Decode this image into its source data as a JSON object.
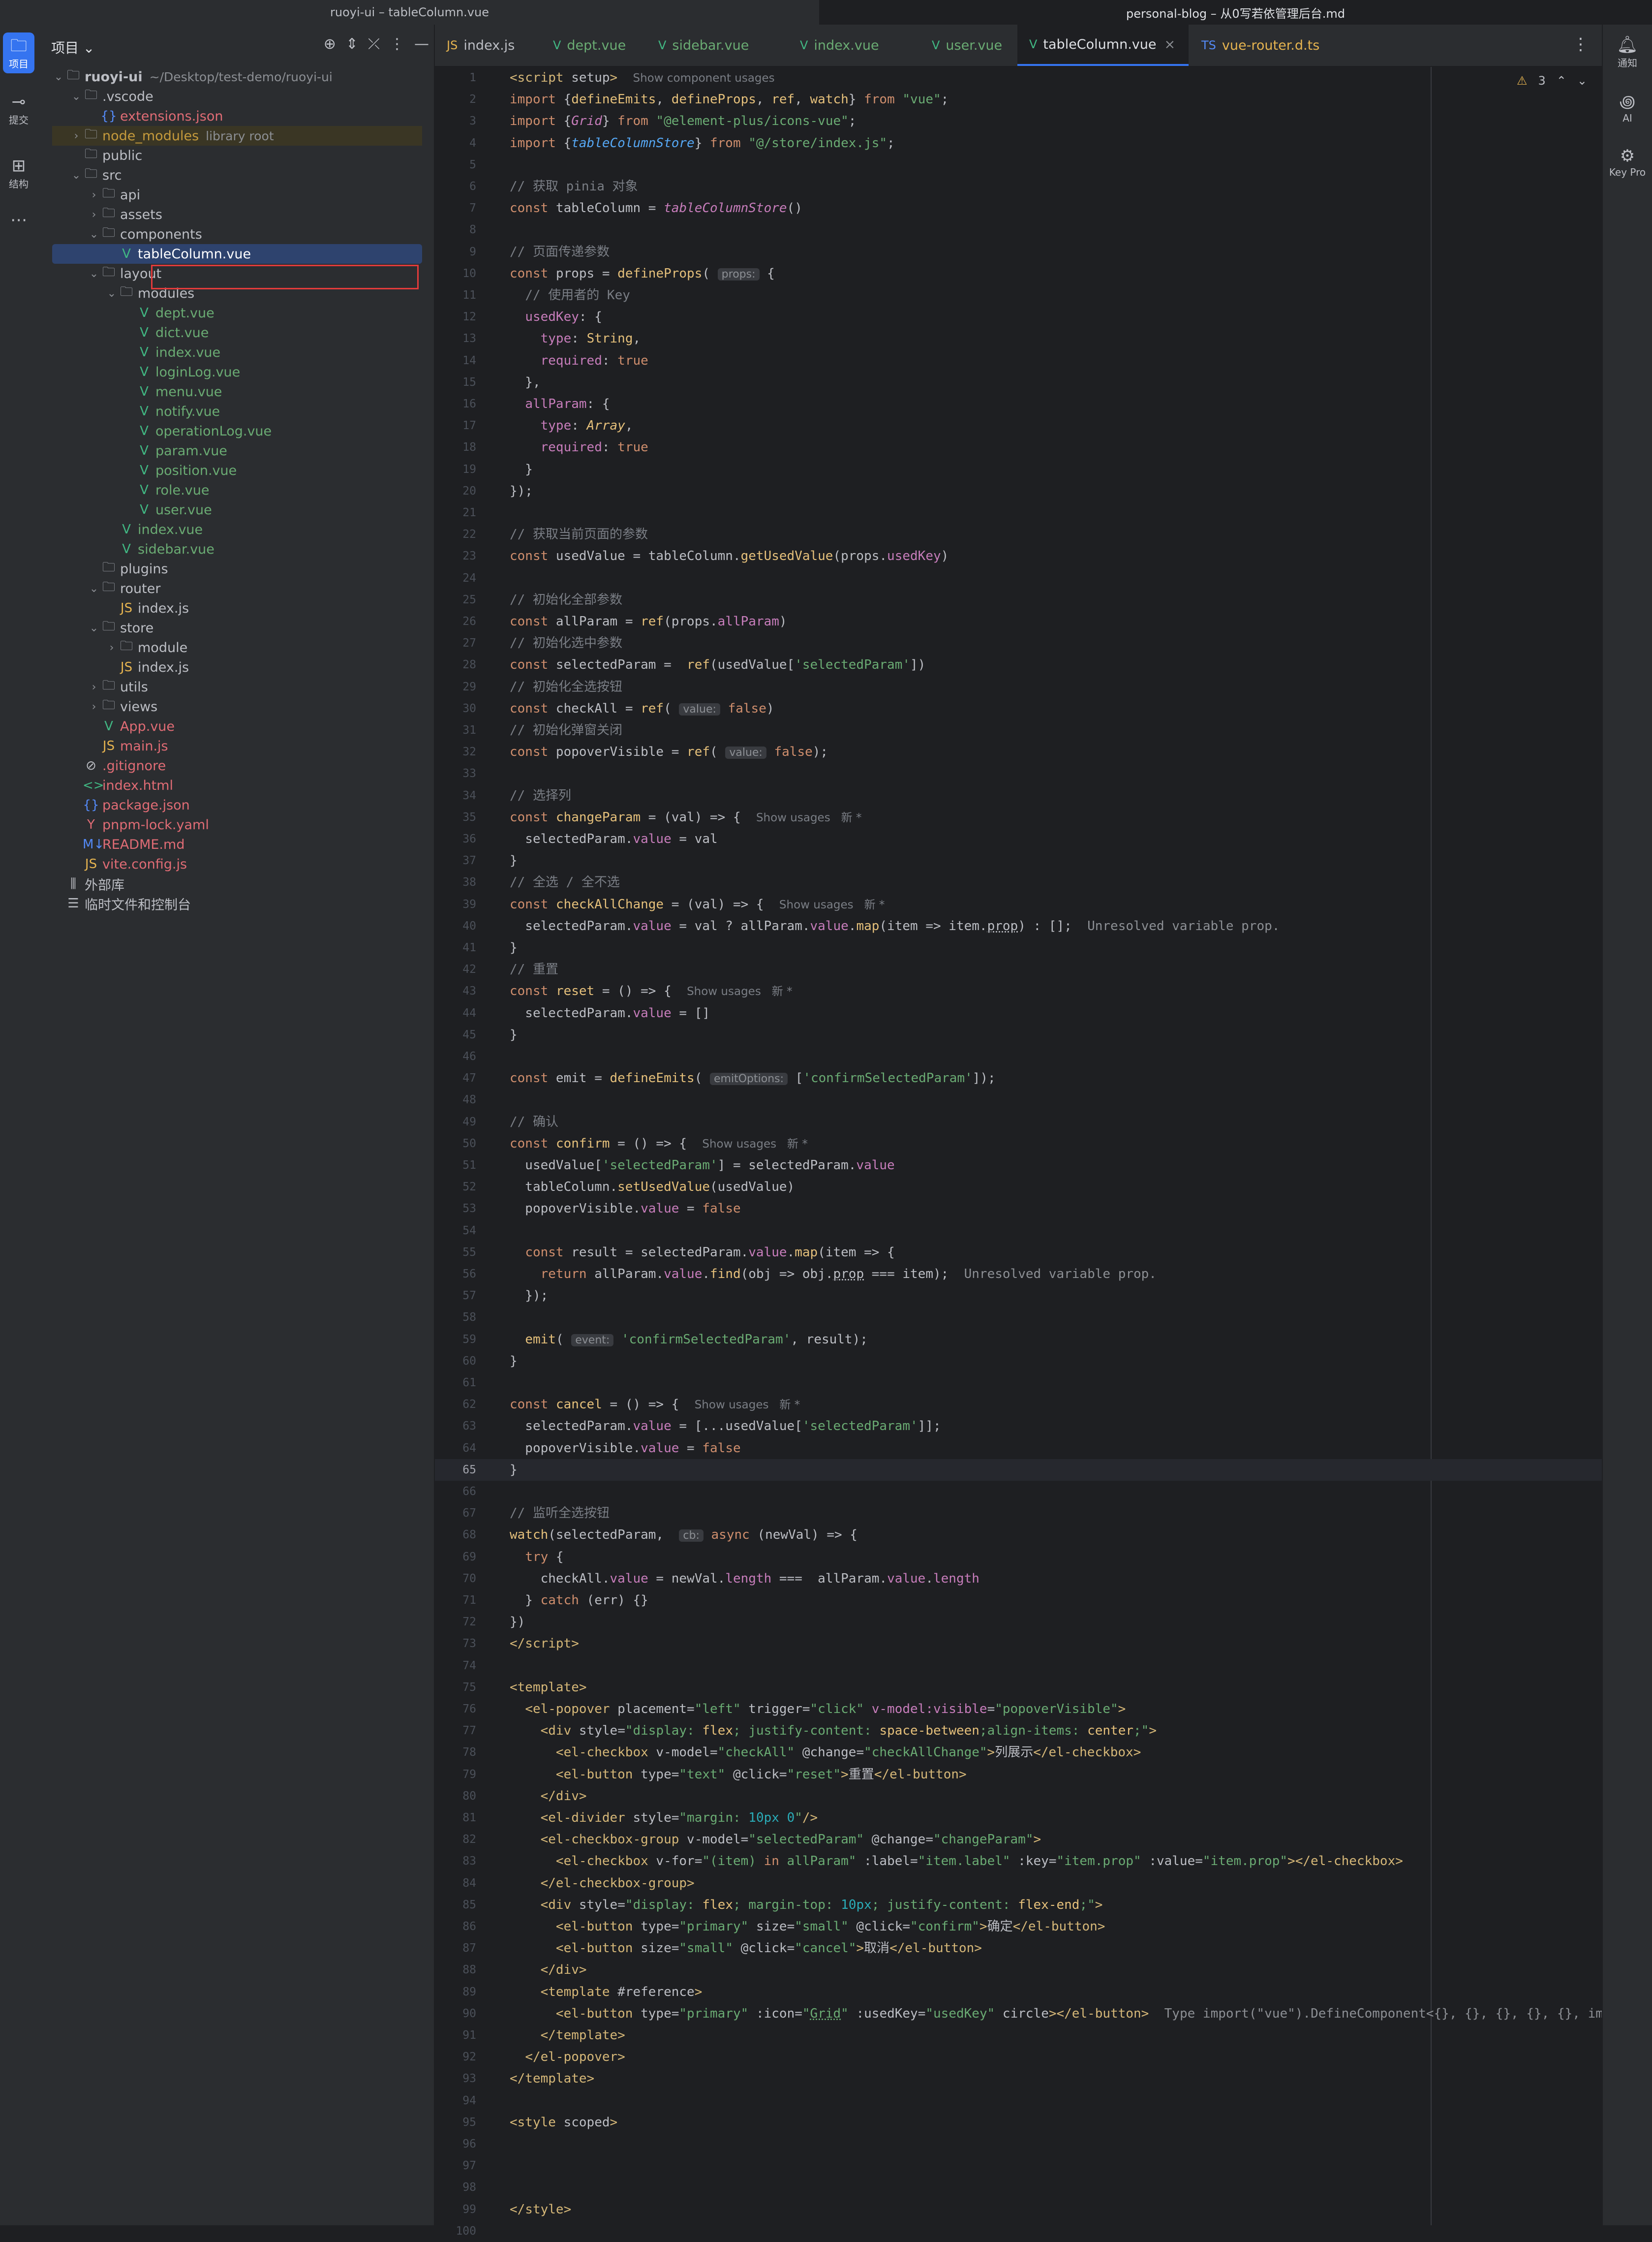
{
  "window": {
    "left_title": "ruoyi-ui – tableColumn.vue",
    "right_title": "personal-blog – 从0写若依管理后台.md"
  },
  "left_activity": [
    {
      "label": "项目",
      "icon": "folder-icon"
    },
    {
      "label": "提交",
      "icon": "commit-icon"
    },
    {
      "label": "结构",
      "icon": "structure-icon"
    },
    {
      "label": "⋯",
      "icon": "more-icon"
    }
  ],
  "right_activity": [
    {
      "label": "通知",
      "icon": "bell-icon"
    },
    {
      "label": "AI",
      "icon": "ai-icon"
    },
    {
      "label": "Key Pro",
      "icon": "key-promoter-icon"
    }
  ],
  "project": {
    "title": "项目",
    "tree": [
      {
        "depth": 0,
        "chev": "v",
        "icon": "folder",
        "label": "ruoyi-ui",
        "hint": "~/Desktop/test-demo/ruoyi-ui",
        "bold": true
      },
      {
        "depth": 1,
        "chev": "v",
        "icon": "folder",
        "label": ".vscode"
      },
      {
        "depth": 2,
        "chev": "",
        "icon": "json",
        "label": "extensions.json",
        "color": "red"
      },
      {
        "depth": 1,
        "chev": ">",
        "icon": "folder",
        "label": "node_modules",
        "hint": "library root",
        "dim": true
      },
      {
        "depth": 1,
        "chev": "",
        "icon": "folder",
        "label": "public"
      },
      {
        "depth": 1,
        "chev": "v",
        "icon": "folder",
        "label": "src"
      },
      {
        "depth": 2,
        "chev": ">",
        "icon": "folder",
        "label": "api"
      },
      {
        "depth": 2,
        "chev": ">",
        "icon": "folder",
        "label": "assets"
      },
      {
        "depth": 2,
        "chev": "v",
        "icon": "folder",
        "label": "components"
      },
      {
        "depth": 3,
        "chev": "",
        "icon": "vue",
        "label": "tableColumn.vue",
        "selected": true
      },
      {
        "depth": 2,
        "chev": "v",
        "icon": "folder",
        "label": "layout"
      },
      {
        "depth": 3,
        "chev": "v",
        "icon": "folder",
        "label": "modules"
      },
      {
        "depth": 4,
        "chev": "",
        "icon": "vue",
        "label": "dept.vue"
      },
      {
        "depth": 4,
        "chev": "",
        "icon": "vue",
        "label": "dict.vue"
      },
      {
        "depth": 4,
        "chev": "",
        "icon": "vue",
        "label": "index.vue"
      },
      {
        "depth": 4,
        "chev": "",
        "icon": "vue",
        "label": "loginLog.vue"
      },
      {
        "depth": 4,
        "chev": "",
        "icon": "vue",
        "label": "menu.vue"
      },
      {
        "depth": 4,
        "chev": "",
        "icon": "vue",
        "label": "notify.vue"
      },
      {
        "depth": 4,
        "chev": "",
        "icon": "vue",
        "label": "operationLog.vue"
      },
      {
        "depth": 4,
        "chev": "",
        "icon": "vue",
        "label": "param.vue"
      },
      {
        "depth": 4,
        "chev": "",
        "icon": "vue",
        "label": "position.vue"
      },
      {
        "depth": 4,
        "chev": "",
        "icon": "vue",
        "label": "role.vue"
      },
      {
        "depth": 4,
        "chev": "",
        "icon": "vue",
        "label": "user.vue"
      },
      {
        "depth": 3,
        "chev": "",
        "icon": "vue",
        "label": "index.vue"
      },
      {
        "depth": 3,
        "chev": "",
        "icon": "vue",
        "label": "sidebar.vue"
      },
      {
        "depth": 2,
        "chev": "",
        "icon": "folder",
        "label": "plugins"
      },
      {
        "depth": 2,
        "chev": "v",
        "icon": "folder",
        "label": "router"
      },
      {
        "depth": 3,
        "chev": "",
        "icon": "js",
        "label": "index.js"
      },
      {
        "depth": 2,
        "chev": "v",
        "icon": "folder",
        "label": "store"
      },
      {
        "depth": 3,
        "chev": ">",
        "icon": "folder",
        "label": "module"
      },
      {
        "depth": 3,
        "chev": "",
        "icon": "js",
        "label": "index.js"
      },
      {
        "depth": 2,
        "chev": ">",
        "icon": "folder",
        "label": "utils"
      },
      {
        "depth": 2,
        "chev": ">",
        "icon": "folder",
        "label": "views"
      },
      {
        "depth": 2,
        "chev": "",
        "icon": "vue",
        "label": "App.vue",
        "color": "red"
      },
      {
        "depth": 2,
        "chev": "",
        "icon": "js",
        "label": "main.js",
        "color": "red"
      },
      {
        "depth": 1,
        "chev": "",
        "icon": "ignore",
        "label": ".gitignore",
        "color": "red"
      },
      {
        "depth": 1,
        "chev": "",
        "icon": "html",
        "label": "index.html",
        "color": "red"
      },
      {
        "depth": 1,
        "chev": "",
        "icon": "json",
        "label": "package.json",
        "color": "red"
      },
      {
        "depth": 1,
        "chev": "",
        "icon": "yaml",
        "label": "pnpm-lock.yaml",
        "color": "red"
      },
      {
        "depth": 1,
        "chev": "",
        "icon": "md",
        "label": "README.md",
        "color": "red"
      },
      {
        "depth": 1,
        "chev": "",
        "icon": "js",
        "label": "vite.config.js",
        "color": "red"
      },
      {
        "depth": 0,
        "chev": "",
        "icon": "lib",
        "label": "外部库",
        "white": true
      },
      {
        "depth": 0,
        "chev": "",
        "icon": "scratch",
        "label": "临时文件和控制台",
        "white": true
      }
    ]
  },
  "tabs": [
    {
      "label": "index.js",
      "icon": "js"
    },
    {
      "label": "dept.vue",
      "icon": "vue"
    },
    {
      "label": "sidebar.vue",
      "icon": "vue"
    },
    {
      "label": "index.vue",
      "icon": "vue"
    },
    {
      "label": "user.vue",
      "icon": "vue"
    },
    {
      "label": "tableColumn.vue",
      "icon": "vue",
      "active": true
    },
    {
      "label": "vue-router.d.ts",
      "icon": "ts"
    }
  ],
  "inspection": {
    "warnings": "3"
  },
  "current_line": 65,
  "code": [
    "<span class='tg'>&lt;script</span> <span class='at'>setup</span><span class='tg'>&gt;</span>  <span class='hint'>Show component usages</span>",
    "<span class='k'>import</span> {<span class='fd'>defineEmits</span>, <span class='fd'>defineProps</span>, <span class='fd'>ref</span>, <span class='fd'>watch</span>} <span class='k'>from</span> <span class='s'>\"vue\"</span>;",
    "<span class='k'>import</span> {<span class='p it'>Grid</span>} <span class='k'>from</span> <span class='s'>\"@element-plus/icons-vue\"</span>;",
    "<span class='k'>import</span> {<span class='fn it'>tableColumnStore</span>} <span class='k'>from</span> <span class='s'>\"@/store/index.js\"</span>;",
    "",
    "<span class='cm'>// 获取 pinia 对象</span>",
    "<span class='k'>const</span> tableColumn = <span class='p it'>tableColumnStore</span>()",
    "",
    "<span class='cm'>// 页面传递参数</span>",
    "<span class='k'>const</span> props = <span class='fd'>defineProps</span>( <span class='inl'>props:</span> {",
    "  <span class='cm'>// 使用者的 Key</span>",
    "  <span class='p'>usedKey</span>: {",
    "    <span class='p'>type</span>: <span class='fd'>String</span>,",
    "    <span class='p'>required</span>: <span class='k'>true</span>",
    "  },",
    "  <span class='p'>allParam</span>: {",
    "    <span class='p'>type</span>: <span class='fd it'>Array</span>,",
    "    <span class='p'>required</span>: <span class='k'>true</span>",
    "  }",
    "});",
    "",
    "<span class='cm'>// 获取当前页面的参数</span>",
    "<span class='k'>const</span> usedValue = tableColumn.<span class='fd'>getUsedValue</span>(props.<span class='p'>usedKey</span>)",
    "",
    "<span class='cm'>// 初始化全部参数</span>",
    "<span class='k'>const</span> allParam = <span class='fd'>ref</span>(props.<span class='p'>allParam</span>)",
    "<span class='cm'>// 初始化选中参数</span>",
    "<span class='k'>const</span> selectedParam =  <span class='fd'>ref</span>(usedValue[<span class='s'>'selectedParam'</span>])",
    "<span class='cm'>// 初始化全选按钮</span>",
    "<span class='k'>const</span> checkAll = <span class='fd'>ref</span>( <span class='inl'>value:</span> <span class='k'>false</span>)",
    "<span class='cm'>// 初始化弹窗关闭</span>",
    "<span class='k'>const</span> popoverVisible = <span class='fd'>ref</span>( <span class='inl'>value:</span> <span class='k'>false</span>);",
    "",
    "<span class='cm'>// 选择列</span>",
    "<span class='k'>const</span> <span class='fd'>changeParam</span> = (val) => {  <span class='hint'>Show usages   新 *</span>",
    "  selectedParam.<span class='p'>value</span> = val",
    "}",
    "<span class='cm'>// 全选 / 全不选</span>",
    "<span class='k'>const</span> <span class='fd'>checkAllChange</span> = (val) => {  <span class='hint'>Show usages   新 *</span>",
    "  selectedParam.<span class='p'>value</span> = val ? allParam.<span class='p'>value</span>.<span class='fd'>map</span>(item => item.<span class='ul'>prop</span>) : [];  <span class='warnmsg'>Unresolved variable prop.</span>",
    "}",
    "<span class='cm'>// 重置</span>",
    "<span class='k'>const</span> <span class='fd'>reset</span> = () => {  <span class='hint'>Show usages   新 *</span>",
    "  selectedParam.<span class='p'>value</span> = []",
    "}",
    "",
    "<span class='k'>const</span> emit = <span class='fd'>defineEmits</span>( <span class='inl'>emitOptions:</span> [<span class='s'>'confirmSelectedParam'</span>]);",
    "",
    "<span class='cm'>// 确认</span>",
    "<span class='k'>const</span> <span class='fd'>confirm</span> = () => {  <span class='hint'>Show usages   新 *</span>",
    "  usedValue[<span class='s'>'selectedParam'</span>] = selectedParam.<span class='p'>value</span>",
    "  tableColumn.<span class='fd'>setUsedValue</span>(usedValue)",
    "  popoverVisible.<span class='p'>value</span> = <span class='k'>false</span>",
    "",
    "  <span class='k'>const</span> result = selectedParam.<span class='p'>value</span>.<span class='fd'>map</span>(item => {",
    "    <span class='k'>return</span> allParam.<span class='p'>value</span>.<span class='fd'>find</span>(obj => obj.<span class='ul'>prop</span> === item);  <span class='warnmsg'>Unresolved variable prop.</span>",
    "  });",
    "",
    "  <span class='fd'>emit</span>( <span class='inl'>event:</span> <span class='s'>'confirmSelectedParam'</span>, result);",
    "}",
    "",
    "<span class='k'>const</span> <span class='fd'>cancel</span> = () => {  <span class='hint'>Show usages   新 *</span>",
    "  selectedParam.<span class='p'>value</span> = [...usedValue[<span class='s'>'selectedParam'</span>]];",
    "  popoverVisible.<span class='p'>value</span> = <span class='k'>false</span>",
    "}",
    "",
    "<span class='cm'>// 监听全选按钮</span>",
    "<span class='fd'>watch</span>(selectedParam,  <span class='inl'>cb:</span> <span class='k'>async</span> (newVal) => {",
    "  <span class='k'>try</span> {",
    "    checkAll.<span class='p'>value</span> = newVal.<span class='p'>length</span> ===  allParam.<span class='p'>value</span>.<span class='p'>length</span>",
    "  } <span class='k'>catch</span> (err) {}",
    "})",
    "<span class='tg'>&lt;/script&gt;</span>",
    "",
    "<span class='tg'>&lt;template&gt;</span>",
    "  <span class='tg'>&lt;el-popover</span> <span class='at'>placement</span>=<span class='av'>\"left\"</span> <span class='at'>trigger</span>=<span class='av'>\"click\"</span> <span class='p'>v-model:visible</span>=<span class='av'>\"popoverVisible\"</span><span class='tg'>&gt;</span>",
    "    <span class='tg'>&lt;div</span> <span class='at'>style</span>=<span class='av'>\"display: <span class='fd'>flex</span>; justify-content: <span class='fd'>space-between</span>;align-items: <span class='fd'>center</span>;\"</span><span class='tg'>&gt;</span>",
    "      <span class='tg'>&lt;el-checkbox</span> <span class='at'>v-model</span>=<span class='av'>\"checkAll\"</span> <span class='at'>@change</span>=<span class='av'>\"checkAllChange\"</span><span class='tg'>&gt;</span>列展示<span class='tg'>&lt;/el-checkbox&gt;</span>",
    "      <span class='tg'>&lt;el-button</span> <span class='at'>type</span>=<span class='av'>\"text\"</span> <span class='at'>@click</span>=<span class='av'>\"reset\"</span><span class='tg'>&gt;</span>重置<span class='tg'>&lt;/el-button&gt;</span>",
    "    <span class='tg'>&lt;/div&gt;</span>",
    "    <span class='tg'>&lt;el-divider</span> <span class='at'>style</span>=<span class='av'>\"margin: <span class='nu'>10px</span> <span class='nu'>0</span>\"</span><span class='tg'>/&gt;</span>",
    "    <span class='tg'>&lt;el-checkbox-group</span> <span class='at'>v-model</span>=<span class='av'>\"selectedParam\"</span> <span class='at'>@change</span>=<span class='av'>\"changeParam\"</span><span class='tg'>&gt;</span>",
    "      <span class='tg'>&lt;el-checkbox</span> <span class='at'>v-for</span>=<span class='av'>\"(item) <span class='k'>in</span> allParam\"</span> <span class='at'>:label</span>=<span class='av'>\"item.label\"</span> <span class='at'>:key</span>=<span class='av'>\"item.prop\"</span> <span class='at'>:value</span>=<span class='av'>\"item.prop\"</span><span class='tg'>&gt;&lt;/el-checkbox&gt;</span>",
    "    <span class='tg'>&lt;/el-checkbox-group&gt;</span>",
    "    <span class='tg'>&lt;div</span> <span class='at'>style</span>=<span class='av'>\"display: <span class='fd'>flex</span>; margin-top: <span class='nu'>10px</span>; justify-content: <span class='fd'>flex-end</span>;\"</span><span class='tg'>&gt;</span>",
    "      <span class='tg'>&lt;el-button</span> <span class='at'>type</span>=<span class='av'>\"primary\"</span> <span class='at'>size</span>=<span class='av'>\"small\"</span> <span class='at'>@click</span>=<span class='av'>\"confirm\"</span><span class='tg'>&gt;</span>确定<span class='tg'>&lt;/el-button&gt;</span>",
    "      <span class='tg'>&lt;el-button</span> <span class='at'>size</span>=<span class='av'>\"small\"</span> <span class='at'>@click</span>=<span class='av'>\"cancel\"</span><span class='tg'>&gt;</span>取消<span class='tg'>&lt;/el-button&gt;</span>",
    "    <span class='tg'>&lt;/div&gt;</span>",
    "    <span class='tg'>&lt;template</span> <span class='at'>#reference</span><span class='tg'>&gt;</span>",
    "      <span class='tg'>&lt;el-button</span> <span class='at'>type</span>=<span class='av'>\"primary\"</span> <span class='at'>:icon</span>=<span class='av'>\"<span class='ul'>Grid</span>\"</span> <span class='at'>:usedKey</span>=<span class='av'>\"usedKey\"</span> <span class='at'>circle</span><span class='tg'>&gt;&lt;/el-button&gt;</span>  <span class='warnmsg'>Type import(\"vue\").DefineComponent&lt;{}, {}, {}, {}, {}, import(</span>",
    "    <span class='tg'>&lt;/template&gt;</span>",
    "  <span class='tg'>&lt;/el-popover&gt;</span>",
    "<span class='tg'>&lt;/template&gt;</span>",
    "",
    "<span class='tg'>&lt;style</span> <span class='at'>scoped</span><span class='tg'>&gt;</span>",
    "",
    "",
    "",
    "<span class='tg'>&lt;/style&gt;</span>",
    ""
  ]
}
